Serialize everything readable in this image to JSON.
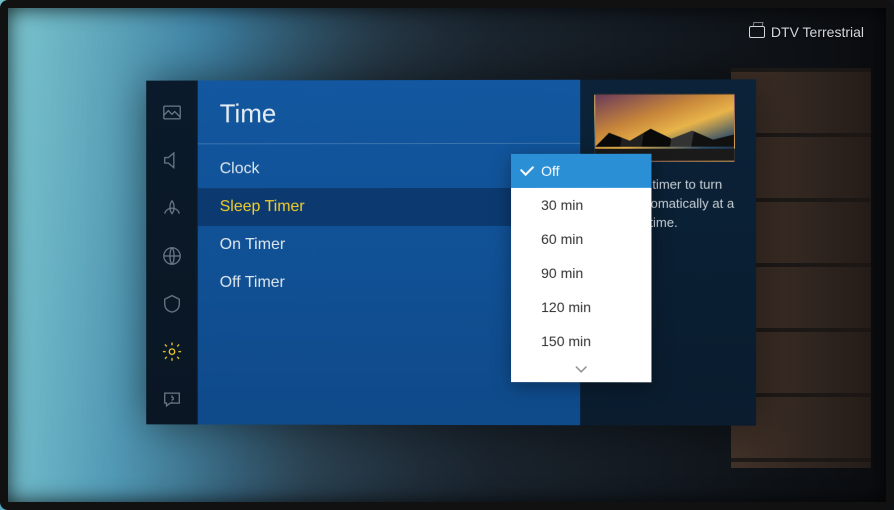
{
  "status": {
    "source": "DTV Terrestrial"
  },
  "rail": {
    "items": [
      {
        "name": "picture-icon"
      },
      {
        "name": "sound-icon"
      },
      {
        "name": "broadcast-icon"
      },
      {
        "name": "network-icon"
      },
      {
        "name": "system-icon"
      },
      {
        "name": "settings-icon",
        "active": true
      },
      {
        "name": "support-icon"
      }
    ]
  },
  "page": {
    "title": "Time"
  },
  "menu": {
    "items": [
      {
        "label": "Clock",
        "selected": false
      },
      {
        "label": "Sleep Timer",
        "selected": true
      },
      {
        "label": "On Timer",
        "selected": false
      },
      {
        "label": "Off Timer",
        "selected": false
      }
    ]
  },
  "popup": {
    "options": [
      {
        "label": "Off",
        "selected": true
      },
      {
        "label": "30 min"
      },
      {
        "label": "60 min"
      },
      {
        "label": "90 min"
      },
      {
        "label": "120 min"
      },
      {
        "label": "150 min"
      }
    ]
  },
  "info": {
    "description": "Set sleep timer to turn TV off automatically at a specified time."
  }
}
